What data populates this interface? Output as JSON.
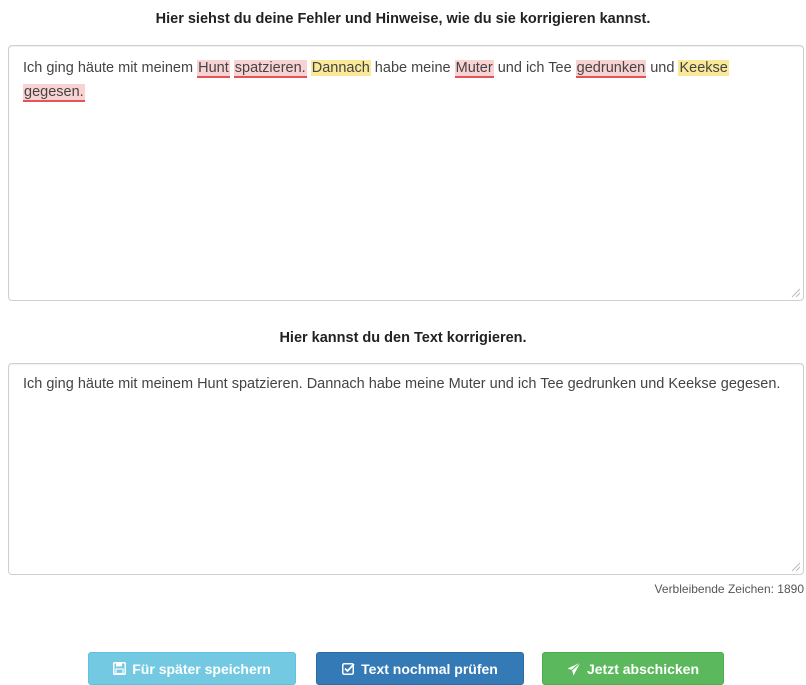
{
  "review": {
    "heading": "Hier siehst du deine Fehler und Hinweise, wie du sie korrigieren kannst.",
    "segments": [
      {
        "text": "Ich ging häute mit meinem ",
        "type": "plain"
      },
      {
        "text": "Hunt",
        "type": "error"
      },
      {
        "text": " ",
        "type": "plain"
      },
      {
        "text": "spatzieren.",
        "type": "error"
      },
      {
        "text": " ",
        "type": "plain"
      },
      {
        "text": "Dannach",
        "type": "hint"
      },
      {
        "text": " habe meine ",
        "type": "plain"
      },
      {
        "text": "Muter",
        "type": "error"
      },
      {
        "text": " und ich Tee ",
        "type": "plain"
      },
      {
        "text": "gedrunken",
        "type": "error"
      },
      {
        "text": " und ",
        "type": "plain"
      },
      {
        "text": "Keekse",
        "type": "hint"
      },
      {
        "text": " ",
        "type": "plain"
      },
      {
        "text": "gegesen.",
        "type": "error"
      }
    ]
  },
  "editor": {
    "heading": "Hier kannst du den Text korrigieren.",
    "value": "Ich ging häute mit meinem Hunt spatzieren. Dannach habe meine Muter und ich Tee gedrunken und Keekse gegesen."
  },
  "counter": {
    "text": "Verbleibende Zeichen: 1890"
  },
  "buttons": {
    "save_label": "Für später speichern",
    "check_label": "Text nochmal prüfen",
    "send_label": "Jetzt abschicken"
  },
  "colors": {
    "error_bg": "#f9d3d3",
    "error_underline": "#e05555",
    "hint_bg": "#fbe99a",
    "save": "#5bc0de",
    "check": "#337ab7",
    "send": "#5cb85c"
  }
}
